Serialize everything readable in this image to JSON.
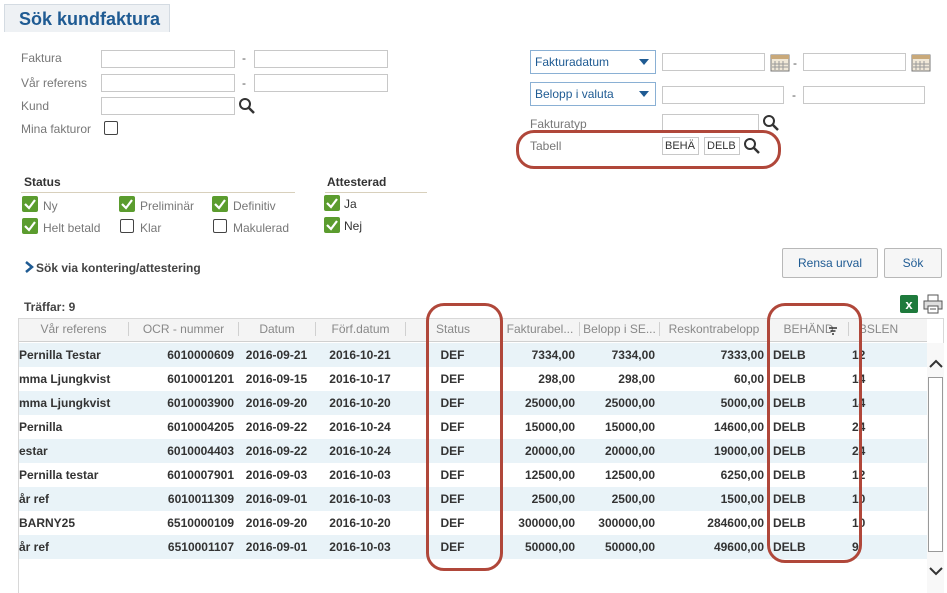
{
  "page": {
    "title": "Sök kundfaktura"
  },
  "form": {
    "faktura_label": "Faktura",
    "var_referens_label": "Vår referens",
    "kund_label": "Kund",
    "mina_fakturor_label": "Mina fakturor",
    "range_dash": "-",
    "fakturadatum_select": "Fakturadatum",
    "belopp_select": "Belopp i valuta",
    "fakturatyp_label": "Fakturatyp",
    "tabell_label": "Tabell",
    "tabell_value1": "BEHÄ",
    "tabell_value2": "DELB"
  },
  "status": {
    "heading": "Status",
    "items": [
      {
        "label": "Ny",
        "checked": true
      },
      {
        "label": "Preliminär",
        "checked": true
      },
      {
        "label": "Definitiv",
        "checked": true
      },
      {
        "label": "Helt betald",
        "checked": true
      },
      {
        "label": "Klar",
        "checked": false
      },
      {
        "label": "Makulerad",
        "checked": false
      }
    ]
  },
  "attesterad": {
    "heading": "Attesterad",
    "items": [
      {
        "label": "Ja",
        "checked": true
      },
      {
        "label": "Nej",
        "checked": true
      }
    ]
  },
  "kontering_link": "Sök via kontering/attestering",
  "buttons": {
    "clear": "Rensa urval",
    "search": "Sök"
  },
  "results": {
    "count_label": "Träffar: 9",
    "columns": [
      "Vår referens",
      "OCR - nummer",
      "Datum",
      "Förf.datum",
      "Status",
      "Fakturabel...",
      "Belopp i SE...",
      "Reskontrabelopp",
      "BEHÄND",
      "BSLEN"
    ],
    "rows": [
      [
        "Pernilla Testar",
        "6010000609",
        "2016-09-21",
        "2016-10-21",
        "DEF",
        "7334,00",
        "7334,00",
        "7333,00",
        "DELB",
        "12"
      ],
      [
        "mma Ljungkvist",
        "6010001201",
        "2016-09-15",
        "2016-10-17",
        "DEF",
        "298,00",
        "298,00",
        "60,00",
        "DELB",
        "14"
      ],
      [
        "mma Ljungkvist",
        "6010003900",
        "2016-09-20",
        "2016-10-20",
        "DEF",
        "25000,00",
        "25000,00",
        "5000,00",
        "DELB",
        "14"
      ],
      [
        "Pernilla",
        "6010004205",
        "2016-09-22",
        "2016-10-24",
        "DEF",
        "15000,00",
        "15000,00",
        "14600,00",
        "DELB",
        "24"
      ],
      [
        "estar",
        "6010004403",
        "2016-09-22",
        "2016-10-24",
        "DEF",
        "20000,00",
        "20000,00",
        "19000,00",
        "DELB",
        "24"
      ],
      [
        "Pernilla testar",
        "6010007901",
        "2016-09-03",
        "2016-10-03",
        "DEF",
        "12500,00",
        "12500,00",
        "6250,00",
        "DELB",
        "12"
      ],
      [
        "år ref",
        "6010011309",
        "2016-09-01",
        "2016-10-03",
        "DEF",
        "2500,00",
        "2500,00",
        "1500,00",
        "DELB",
        "10"
      ],
      [
        "BARNY25",
        "6510000109",
        "2016-09-20",
        "2016-10-20",
        "DEF",
        "300000,00",
        "300000,00",
        "284600,00",
        "DELB",
        "10"
      ],
      [
        "år ref",
        "6510001107",
        "2016-09-01",
        "2016-10-03",
        "DEF",
        "50000,00",
        "50000,00",
        "49600,00",
        "DELB",
        "9"
      ]
    ]
  },
  "colors": {
    "accent": "#1f5b93",
    "check": "#5b9c2e",
    "highlight": "#b0473a",
    "alt_row": "#e9f3f8"
  }
}
